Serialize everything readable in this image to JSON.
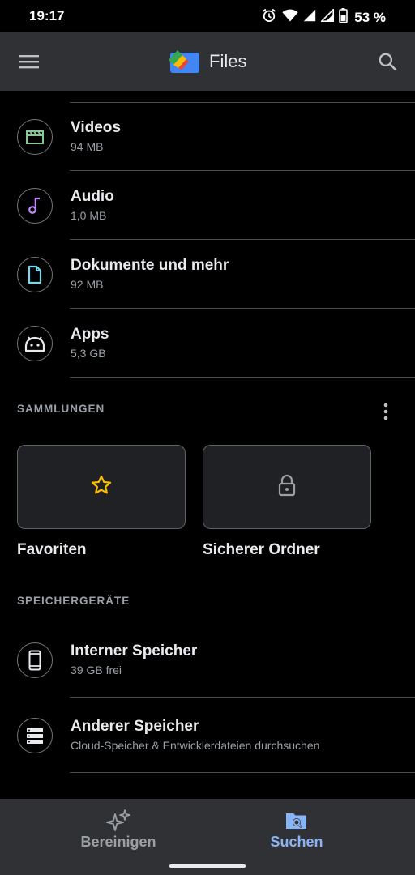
{
  "status_bar": {
    "time": "19:17",
    "battery": "53 %"
  },
  "app_bar": {
    "title": "Files"
  },
  "categories": [
    {
      "title": "Videos",
      "size": "94 MB",
      "icon": "video-clapper-icon",
      "color": "#81c995"
    },
    {
      "title": "Audio",
      "size": "1,0 MB",
      "icon": "music-note-icon",
      "color": "#c58af9"
    },
    {
      "title": "Dokumente und mehr",
      "size": "92 MB",
      "icon": "document-icon",
      "color": "#78d9ec"
    },
    {
      "title": "Apps",
      "size": "5,3 GB",
      "icon": "android-icon",
      "color": "#e8eaed"
    }
  ],
  "collections": {
    "header": "SAMMLUNGEN",
    "items": [
      {
        "label": "Favoriten",
        "icon": "star-icon",
        "color": "#fbbc04"
      },
      {
        "label": "Sicherer Ordner",
        "icon": "lock-icon",
        "color": "#9aa0a6"
      }
    ]
  },
  "storage": {
    "header": "SPEICHERGERÄTE",
    "items": [
      {
        "title": "Interner Speicher",
        "subtitle": "39 GB frei",
        "icon": "phone-icon"
      },
      {
        "title": "Anderer Speicher",
        "subtitle": "Cloud-Speicher & Entwicklerdateien durchsuchen",
        "icon": "storage-icon"
      }
    ]
  },
  "bottom_nav": {
    "items": [
      {
        "label": "Bereinigen",
        "icon": "sparkle-icon",
        "active": false
      },
      {
        "label": "Suchen",
        "icon": "folder-search-icon",
        "active": true
      }
    ]
  },
  "colors": {
    "accent": "#8ab4f8",
    "surface": "#303134",
    "background": "#000000"
  }
}
